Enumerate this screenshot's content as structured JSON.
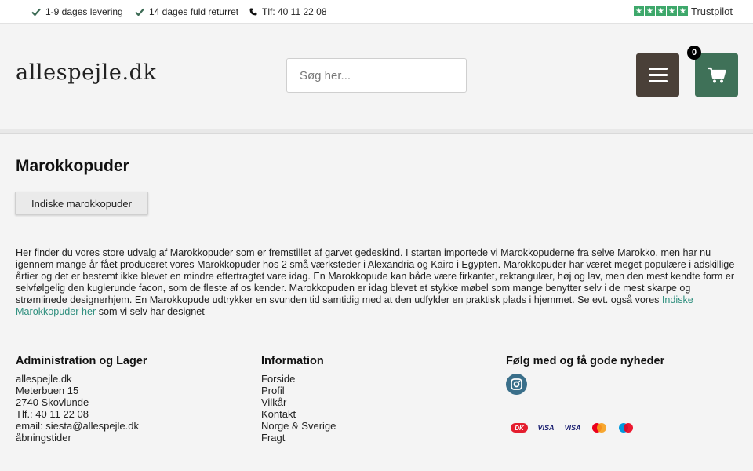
{
  "topbar": {
    "usp1": "1-9 dages levering",
    "usp2": "14 dages fuld returret",
    "phone": "Tlf: 40 11 22 08",
    "trustpilot": "Trustpilot",
    "star_color": "#3ea86b"
  },
  "header": {
    "logo": "allespejle.dk",
    "search_placeholder": "Søg her...",
    "cart_count": "0",
    "menu_color": "#4a4038",
    "cart_color": "#3f7158"
  },
  "main": {
    "title": "Marokkopuder",
    "sub_button": "Indiske marokkopuder",
    "description": "Her finder du vores store udvalg af Marokkopuder som er fremstillet af garvet gedeskind. I starten importede vi Marokkopuderne fra selve Marokko, men har nu igennem mange år fået produceret vores Marokkopuder hos 2 små værksteder i Alexandria og Kairo i Egypten. Marokkopuder har været meget populære i adskillige årtier og det er bestemt ikke blevet en mindre eftertragtet vare idag. En Marokkopude kan både være firkantet, rektangulær, høj og lav, men den mest kendte form er selvfølgelig den kuglerunde facon, som de fleste af os kender. Marokkopuden er idag blevet et stykke møbel som mange benytter selv i de mest skarpe og strømlinede designerhjem. En Marokkopude udtrykker en svunden tid samtidig med at den udfylder en praktisk plads i hjemmet. Se evt. også vores",
    "link_text": "Indiske Marokkopuder her",
    "description_end": " som vi selv har designet",
    "link_color": "#2f8f7e"
  },
  "footer": {
    "admin": {
      "heading": "Administration og Lager",
      "lines": [
        "allespejle.dk",
        "Meterbuen 15",
        "2740 Skovlunde",
        "Tlf.: 40 11 22 08",
        "email: siesta@allespejle.dk",
        "åbningstider"
      ]
    },
    "info": {
      "heading": "Information",
      "links": [
        "Forside",
        "Profil",
        "Vilkår",
        "Kontakt",
        "Norge & Sverige",
        "Fragt"
      ]
    },
    "social": {
      "heading": "Følg med og få gode nyheder",
      "instagram_icon": "instagram-icon"
    },
    "payments": [
      "DK",
      "VISA",
      "VISA",
      "mastercard",
      "maestro"
    ]
  }
}
